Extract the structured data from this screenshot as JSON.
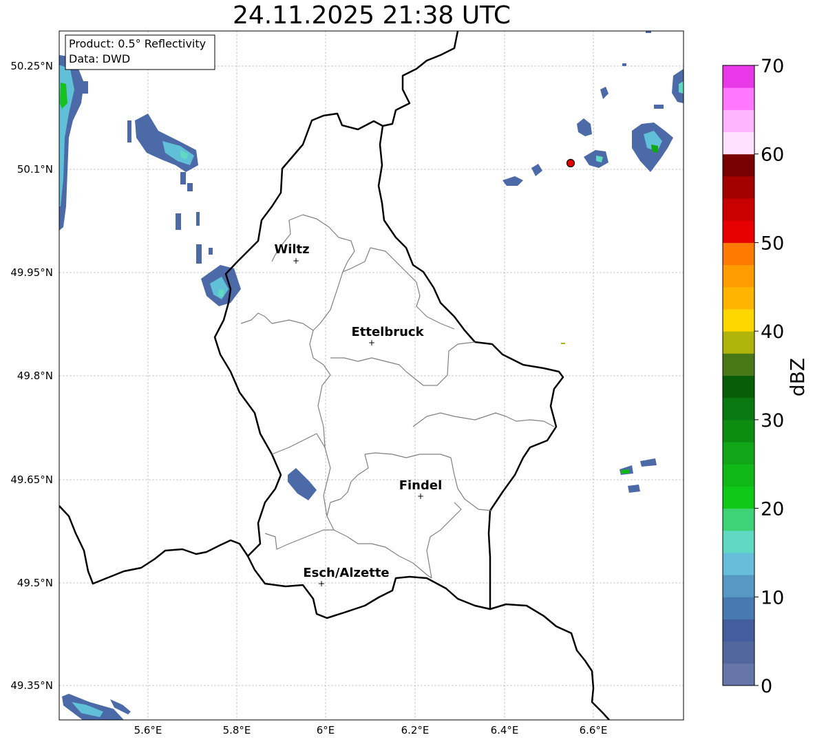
{
  "title": "24.11.2025 21:38 UTC",
  "info_box": {
    "product": "Product: 0.5° Reflectivity",
    "data": "Data: DWD"
  },
  "axes": {
    "lat_labels": [
      "50.25°N",
      "50.1°N",
      "49.95°N",
      "49.8°N",
      "49.65°N",
      "49.5°N",
      "49.35°N"
    ],
    "lon_labels": [
      "5.6°E",
      "5.8°E",
      "6°E",
      "6.2°E",
      "6.4°E",
      "6.6°E"
    ],
    "grid": true
  },
  "cities": [
    {
      "name": "Wiltz",
      "lon": 5.93,
      "lat": 49.97
    },
    {
      "name": "Ettelbruck",
      "lon": 6.1,
      "lat": 49.85
    },
    {
      "name": "Findel",
      "lon": 6.21,
      "lat": 49.63
    },
    {
      "name": "Esch/Alzette",
      "lon": 5.99,
      "lat": 49.5
    }
  ],
  "radar_site": {
    "lon": 6.55,
    "lat": 50.11,
    "color": "#e00000"
  },
  "colorbar": {
    "label": "dBZ",
    "min": 0,
    "max": 70,
    "ticks": [
      "0",
      "10",
      "20",
      "30",
      "40",
      "50",
      "60",
      "70"
    ],
    "colors": [
      "#6676a8",
      "#52679e",
      "#445d9e",
      "#4879b0",
      "#5898c4",
      "#66bedb",
      "#60d9c3",
      "#40d276",
      "#10c818",
      "#10b818",
      "#10a618",
      "#0e8c12",
      "#0a7810",
      "#085e08",
      "#487818",
      "#b0b408",
      "#ffd600",
      "#ffb400",
      "#ff9c00",
      "#ff7a00",
      "#e80000",
      "#c80000",
      "#a40000",
      "#780000",
      "#ffe0ff",
      "#ffb4ff",
      "#ff78ff",
      "#e838e8"
    ]
  },
  "colors": {
    "national_border": "#000000",
    "canton_border": "#808080",
    "grid": "#bbbbbb"
  }
}
